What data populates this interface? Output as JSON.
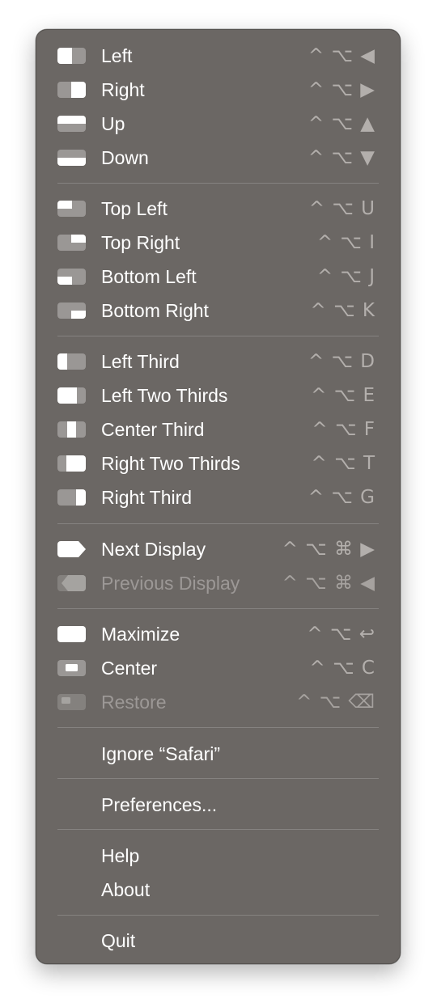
{
  "colors": {
    "menu_background": "#6b6764",
    "label": "#ffffff",
    "shortcut": "#b3afac",
    "disabled_label": "#9c9896",
    "separator": "#858280",
    "icon_window": "#9a9795",
    "icon_fill": "#ffffff"
  },
  "items": [
    {
      "id": "left",
      "label": "Left",
      "shortcut": "^ ⌥ ◀",
      "icon": "half-left-icon",
      "enabled": true
    },
    {
      "id": "right",
      "label": "Right",
      "shortcut": "^ ⌥ ▶",
      "icon": "half-right-icon",
      "enabled": true
    },
    {
      "id": "up",
      "label": "Up",
      "shortcut": "^ ⌥ ▲",
      "icon": "half-top-icon",
      "enabled": true
    },
    {
      "id": "down",
      "label": "Down",
      "shortcut": "^ ⌥ ▼",
      "icon": "half-bottom-icon",
      "enabled": true
    },
    {
      "id": "top-left",
      "label": "Top Left",
      "shortcut": "^ ⌥ U",
      "icon": "quarter-top-left-icon",
      "enabled": true
    },
    {
      "id": "top-right",
      "label": "Top Right",
      "shortcut": "^ ⌥  I",
      "icon": "quarter-top-right-icon",
      "enabled": true
    },
    {
      "id": "bottom-left",
      "label": "Bottom Left",
      "shortcut": "^ ⌥  J",
      "icon": "quarter-bottom-left-icon",
      "enabled": true
    },
    {
      "id": "bottom-right",
      "label": "Bottom Right",
      "shortcut": "^ ⌥ K",
      "icon": "quarter-bottom-right-icon",
      "enabled": true
    },
    {
      "id": "left-third",
      "label": "Left Third",
      "shortcut": "^ ⌥ D",
      "icon": "left-third-icon",
      "enabled": true
    },
    {
      "id": "left-two-thirds",
      "label": "Left Two Thirds",
      "shortcut": "^ ⌥ E",
      "icon": "left-two-thirds-icon",
      "enabled": true
    },
    {
      "id": "center-third",
      "label": "Center Third",
      "shortcut": "^ ⌥ F",
      "icon": "center-third-icon",
      "enabled": true
    },
    {
      "id": "right-two-thirds",
      "label": "Right Two Thirds",
      "shortcut": "^ ⌥ T",
      "icon": "right-two-thirds-icon",
      "enabled": true
    },
    {
      "id": "right-third",
      "label": "Right Third",
      "shortcut": "^ ⌥ G",
      "icon": "right-third-icon",
      "enabled": true
    },
    {
      "id": "next-display",
      "label": "Next Display",
      "shortcut": "^ ⌥ ⌘ ▶",
      "icon": "next-display-icon",
      "enabled": true
    },
    {
      "id": "previous-display",
      "label": "Previous Display",
      "shortcut": "^ ⌥ ⌘ ◀",
      "icon": "previous-display-icon",
      "enabled": false
    },
    {
      "id": "maximize",
      "label": "Maximize",
      "shortcut": "^ ⌥ ↩",
      "icon": "maximize-icon",
      "enabled": true
    },
    {
      "id": "center",
      "label": "Center",
      "shortcut": "^ ⌥ C",
      "icon": "center-icon",
      "enabled": true
    },
    {
      "id": "restore",
      "label": "Restore",
      "shortcut": "^ ⌥ ⌫",
      "icon": "restore-icon",
      "enabled": false
    },
    {
      "id": "ignore-app",
      "label": "Ignore “Safari”",
      "shortcut": "",
      "icon": "",
      "enabled": true
    },
    {
      "id": "preferences",
      "label": "Preferences...",
      "shortcut": "",
      "icon": "",
      "enabled": true
    },
    {
      "id": "help",
      "label": "Help",
      "shortcut": "",
      "icon": "",
      "enabled": true
    },
    {
      "id": "about",
      "label": "About",
      "shortcut": "",
      "icon": "",
      "enabled": true
    },
    {
      "id": "quit",
      "label": "Quit",
      "shortcut": "",
      "icon": "",
      "enabled": true
    }
  ]
}
